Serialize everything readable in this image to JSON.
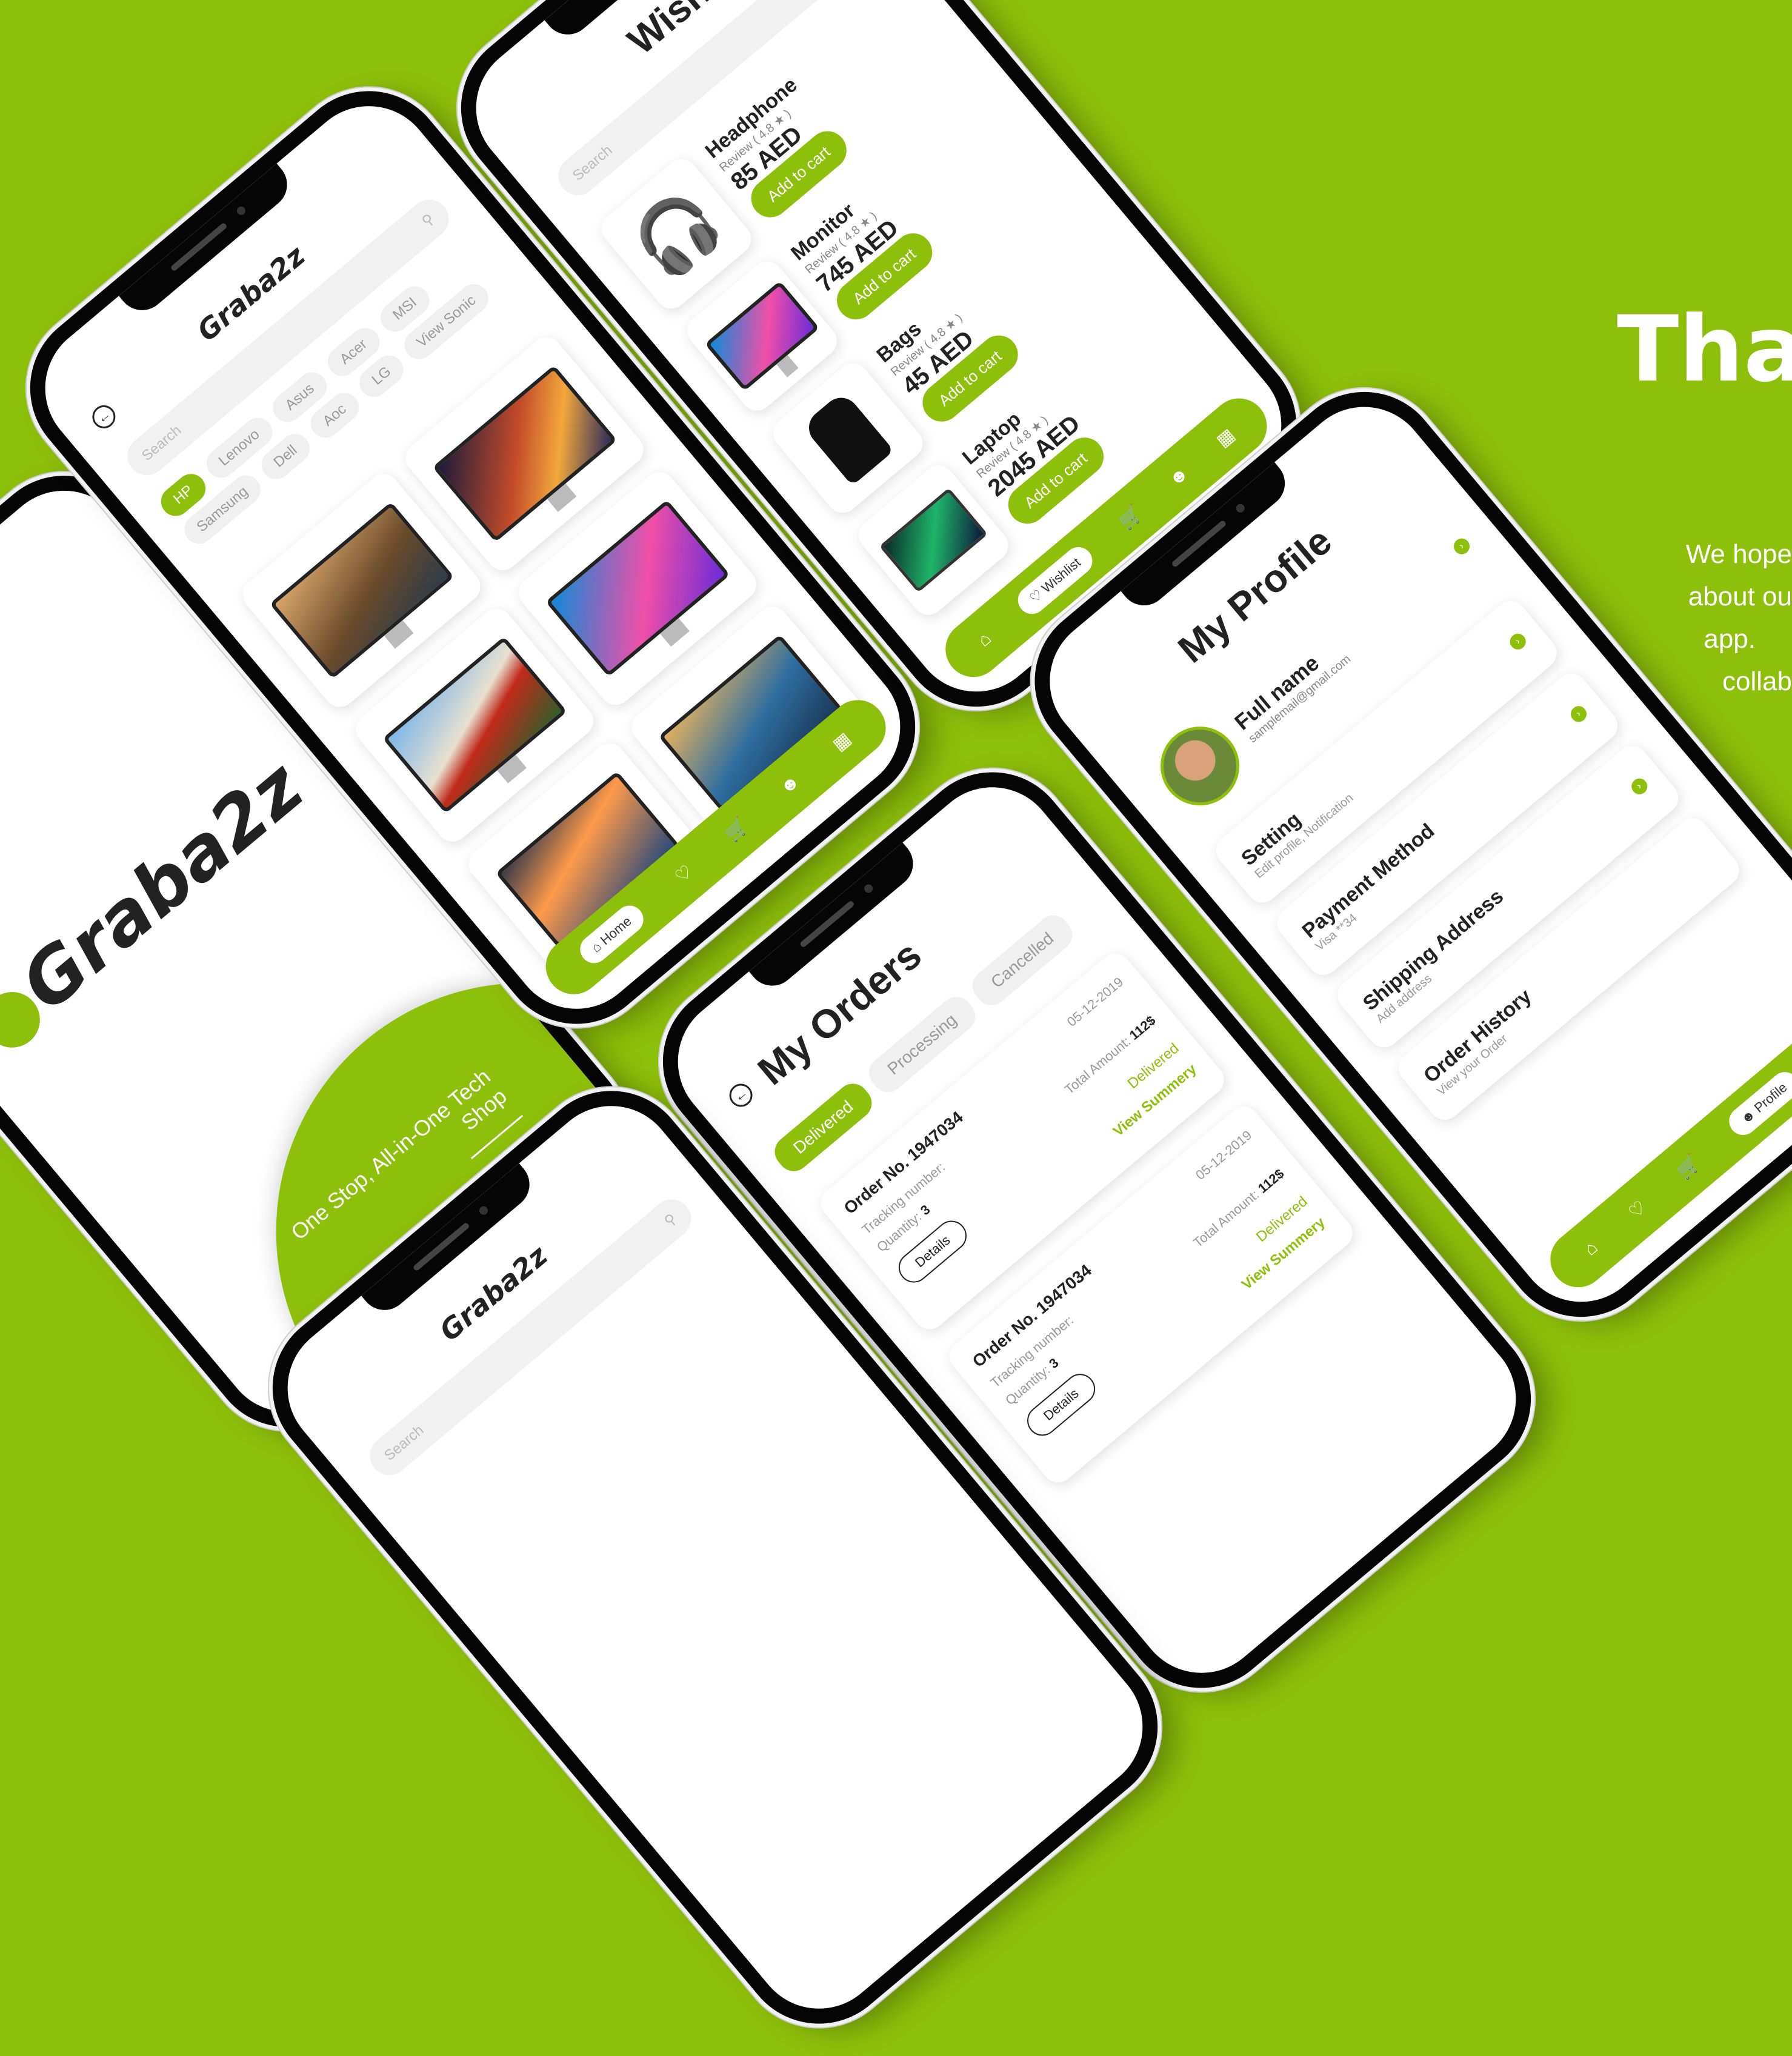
{
  "brand": {
    "logo_text": "Graba2z",
    "tagline": "One Stop, All-in-One Tech Shop"
  },
  "thanks": {
    "title": "Tha",
    "body_lines": [
      "We hope",
      "about ou",
      "app.",
      "collab"
    ]
  },
  "home": {
    "search_placeholder": "Search",
    "brands": [
      "HP",
      "Lenovo",
      "Asus",
      "Acer",
      "MSI",
      "Samsung",
      "Dell",
      "Aoc",
      "LG",
      "View Sonic"
    ],
    "nav_active": "Home"
  },
  "wishlist": {
    "title": "Wish",
    "search_placeholder": "Search",
    "items": [
      {
        "name": "Headphone",
        "review": "Review ( 4.8 ★ )",
        "price": "85 AED",
        "cta": "Add to cart"
      },
      {
        "name": "Monitor",
        "review": "Review ( 4.8 ★ )",
        "price": "745 AED",
        "cta": "Add to cart"
      },
      {
        "name": "Bags",
        "review": "Review ( 4.8 ★ )",
        "price": "45 AED",
        "cta": "Add to cart"
      },
      {
        "name": "Laptop",
        "review": "Review ( 4.8 ★ )",
        "price": "2045 AED",
        "cta": "Add to cart"
      }
    ],
    "nav_active": "Wishlist"
  },
  "orders": {
    "title": "My Orders",
    "tabs": [
      "Delivered",
      "Processing",
      "Cancelled"
    ],
    "items": [
      {
        "order_no": "Order No. 1947034",
        "date": "05-12-2019",
        "tracking_label": "Tracking number:",
        "quantity_label": "Quantity:",
        "quantity": "3",
        "total_label": "Total Amount:",
        "total": "112$",
        "status": "Delivered",
        "details": "Details",
        "summary": "View Summery"
      },
      {
        "order_no": "Order No. 1947034",
        "date": "05-12-2019",
        "tracking_label": "Tracking number:",
        "quantity_label": "Quantity:",
        "quantity": "3",
        "total_label": "Total Amount:",
        "total": "112$",
        "status": "Delivered",
        "details": "Details",
        "summary": "View Summery"
      }
    ]
  },
  "profile": {
    "title": "My Profile",
    "name": "Full name",
    "email": "samplemail@gmail.com",
    "menu": [
      {
        "label": "Setting",
        "sub": "Edit profile, Notification"
      },
      {
        "label": "Payment Method",
        "sub": "Visa **34"
      },
      {
        "label": "Shipping Address",
        "sub": "Add address"
      },
      {
        "label": "Order History",
        "sub": "View your Order"
      }
    ],
    "nav_active": "Profile"
  },
  "colors": {
    "accent": "#8dc00b",
    "phone_frame": "#050505",
    "text_dark": "#222222"
  }
}
